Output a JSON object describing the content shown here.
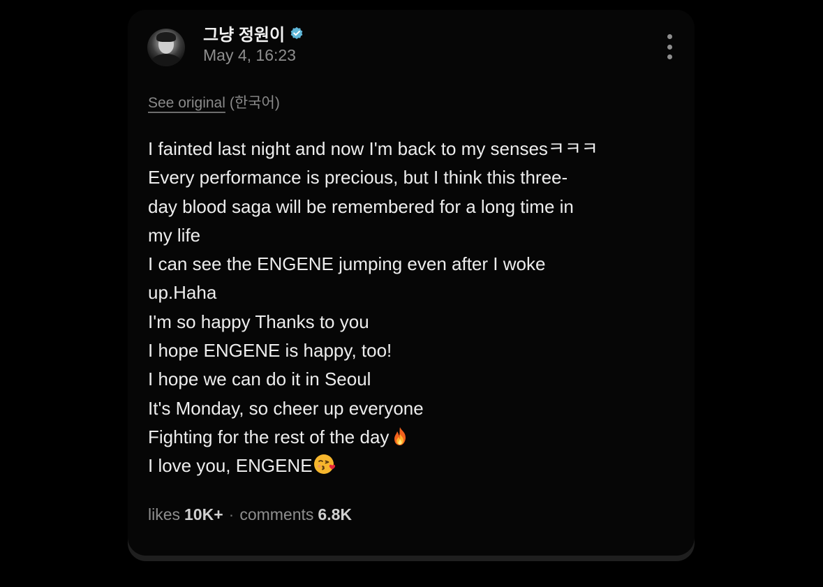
{
  "post": {
    "author": "그냥 정원이",
    "timestamp": "May 4, 16:23",
    "see_original": "See original",
    "original_language": "(한국어)",
    "lines": [
      "I fainted last night and now I'm back to my sensesㅋㅋㅋ",
      "Every performance is precious, but I think this three-",
      "day blood saga will be remembered for a long time in",
      "my life",
      "I can see the ENGENE jumping even after I woke",
      "up.Haha",
      "I'm so happy Thanks to you",
      "I hope ENGENE is happy, too!",
      "I hope we can do it in Seoul",
      "It's Monday, so cheer up everyone",
      "Fighting for the rest of the day",
      "I love you, ENGENE"
    ],
    "emojis": {
      "fire": "fire-emoji",
      "kiss": "face-blowing-kiss-emoji"
    },
    "likes_label": "likes",
    "likes_value": "10K+",
    "separator": "·",
    "comments_label": "comments",
    "comments_value": "6.8K"
  },
  "colors": {
    "background": "#000000",
    "card": "#060606",
    "verified_badge": "#5fb7d9",
    "muted_text": "#8e8e8e",
    "body_text": "#ededed"
  }
}
